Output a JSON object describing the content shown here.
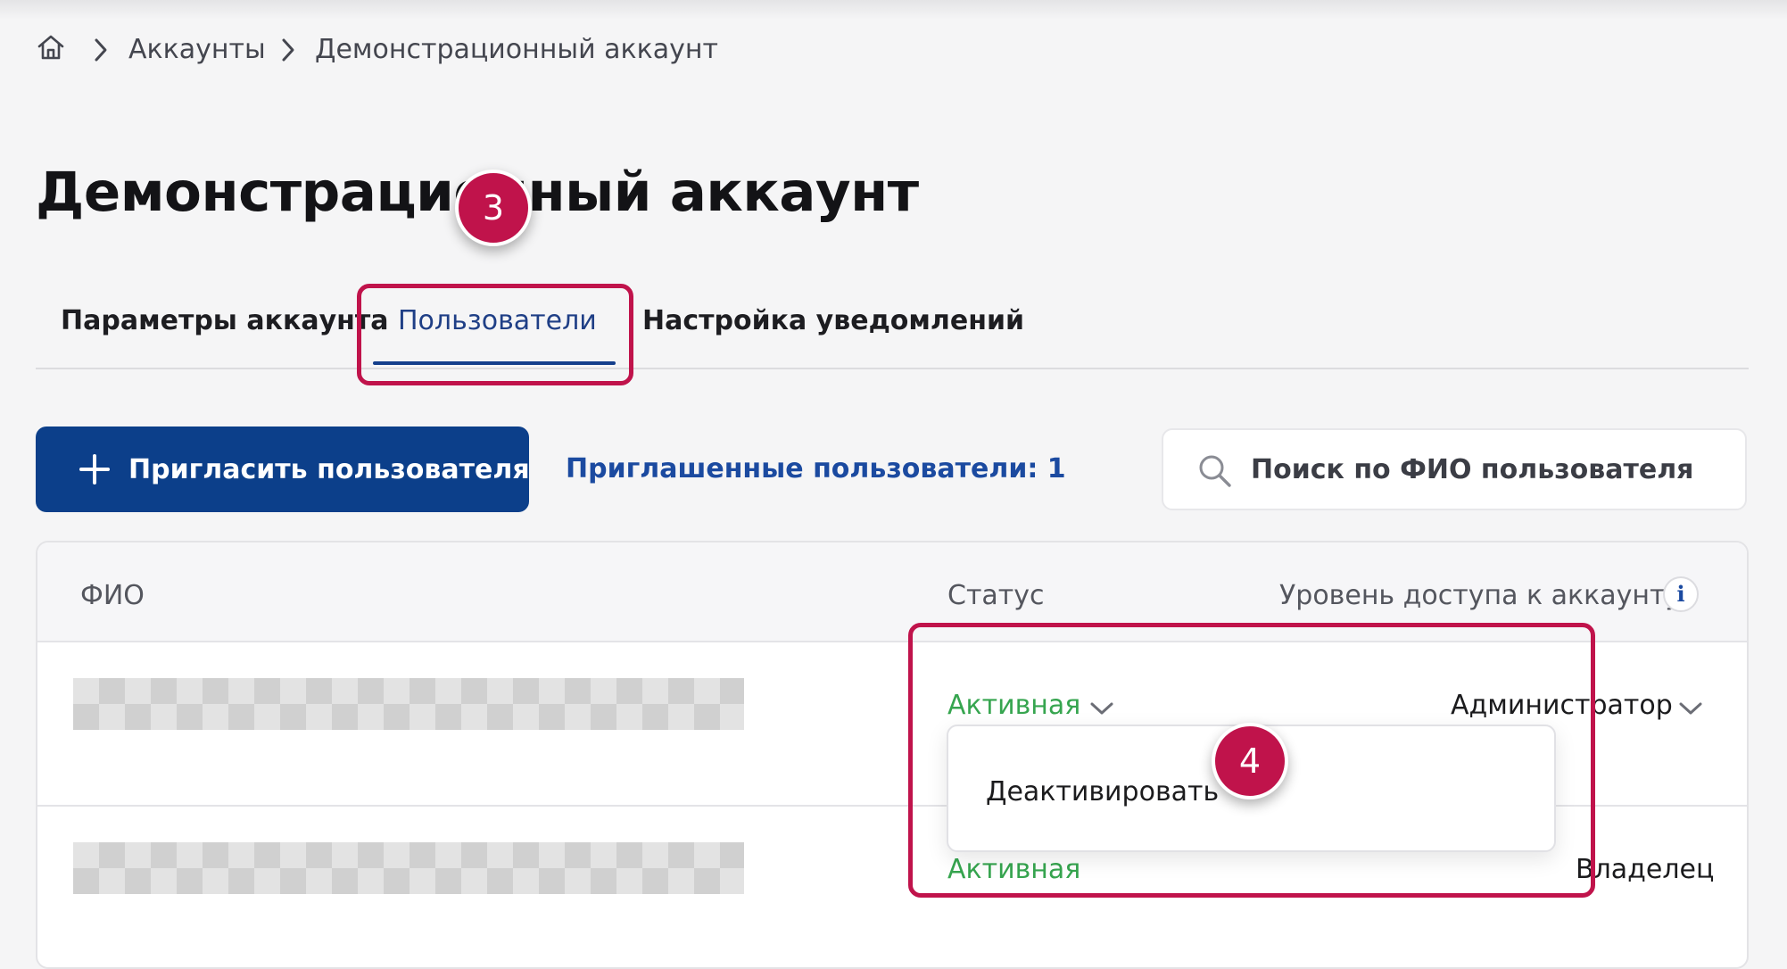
{
  "breadcrumb": {
    "items": [
      "Аккаунты",
      "Демонстрационный аккаунт"
    ]
  },
  "page": {
    "title": "Демонстрационный аккаунт"
  },
  "tabs": [
    {
      "label": "Параметры аккаунта",
      "active": false
    },
    {
      "label": "Пользователи",
      "active": true
    },
    {
      "label": "Настройка уведомлений",
      "active": false
    }
  ],
  "toolbar": {
    "invite_label": "Пригласить пользователя",
    "invited_link": "Приглашенные пользователи: 1"
  },
  "search": {
    "placeholder": "Поиск по ФИО пользователя"
  },
  "table": {
    "headers": {
      "name": "ФИО",
      "status": "Статус",
      "access": "Уровень доступа к аккаунту",
      "info": "i"
    },
    "rows": [
      {
        "status": "Активная",
        "role": "Администратор"
      },
      {
        "status": "Активная",
        "role": "Владелец"
      }
    ]
  },
  "dropdown": {
    "items": [
      "Деактивировать"
    ]
  },
  "annotations": {
    "step_a": "3",
    "step_b": "4"
  },
  "colors": {
    "primary": "#0c3f8a",
    "link": "#1b4aa0",
    "active_tab": "#1f3f86",
    "status_active": "#36a54f",
    "annotation": "#c0134b"
  },
  "icons": [
    "home-icon",
    "chevron-right-icon",
    "plus-icon",
    "search-icon",
    "info-icon",
    "chevron-down-icon"
  ]
}
